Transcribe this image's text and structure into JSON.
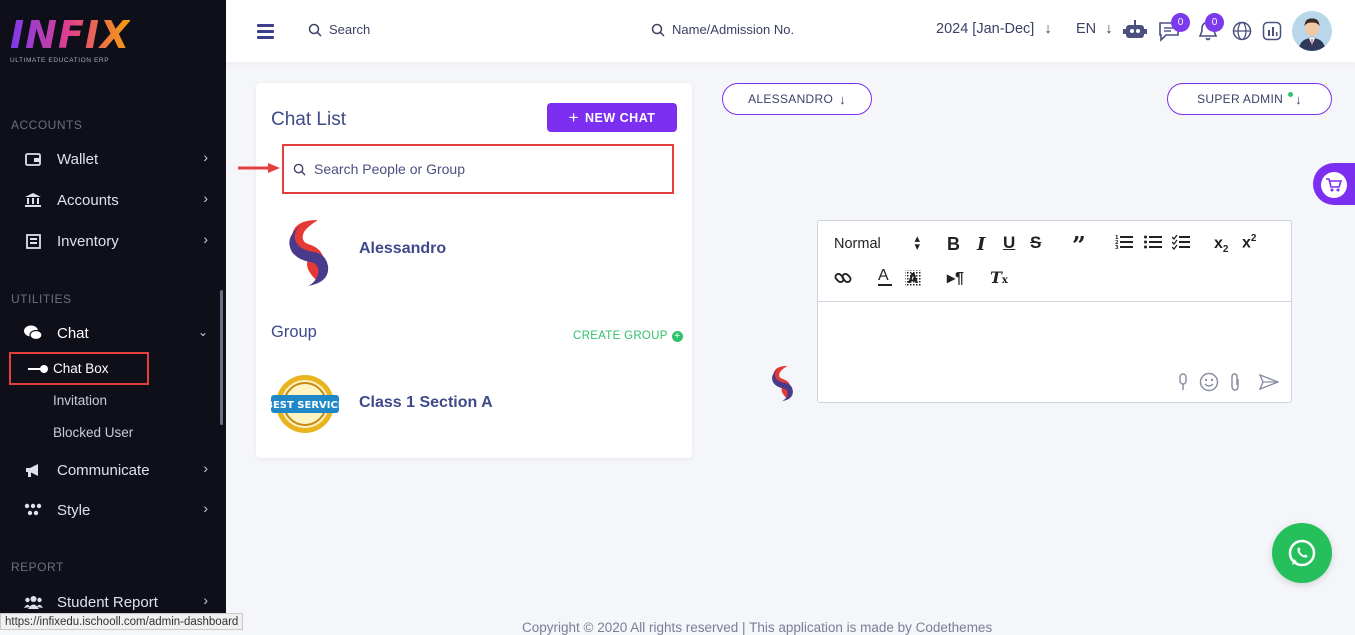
{
  "brand": {
    "name": "INFIX",
    "tagline": "ULTIMATE EDUCATION ERP"
  },
  "sidebar": {
    "sections": {
      "accounts": "ACCOUNTS",
      "utilities": "UTILITIES",
      "report": "REPORT"
    },
    "items": [
      {
        "label": "Wallet",
        "icon": "wallet-icon"
      },
      {
        "label": "Accounts",
        "icon": "bank-icon"
      },
      {
        "label": "Inventory",
        "icon": "inventory-icon"
      },
      {
        "label": "Chat",
        "icon": "chat-icon"
      },
      {
        "label": "Communicate",
        "icon": "megaphone-icon"
      },
      {
        "label": "Style",
        "icon": "style-icon"
      },
      {
        "label": "Student Report",
        "icon": "users-icon"
      }
    ],
    "chat_sub": [
      "Chat Box",
      "Invitation",
      "Blocked User"
    ]
  },
  "topbar": {
    "search_label": "Search",
    "search2_label": "Name/Admission No.",
    "year": "2024 [Jan-Dec]",
    "lang": "EN",
    "messages_count": "0",
    "notifications_count": "0"
  },
  "chat_list": {
    "title": "Chat List",
    "new_chat_label": "NEW CHAT",
    "search_placeholder": "Search People or Group",
    "contacts": [
      {
        "name": "Alessandro"
      }
    ],
    "group_title": "Group",
    "create_group_label": "CREATE GROUP",
    "groups": [
      {
        "name": "Class 1 Section A"
      }
    ]
  },
  "conversation": {
    "recipient": "ALESSANDRO",
    "role": "SUPER ADMIN"
  },
  "editor": {
    "format_select": "Normal"
  },
  "footer": {
    "text": "Copyright © 2020 All rights reserved | This application is made by Codethemes"
  },
  "status_url": "https://infixedu.ischooll.com/admin-dashboard",
  "colors": {
    "accent": "#7c2ff0",
    "highlight": "#e53e3e",
    "whatsapp": "#25c05c",
    "sidebar_bg": "#0f0f1a"
  }
}
